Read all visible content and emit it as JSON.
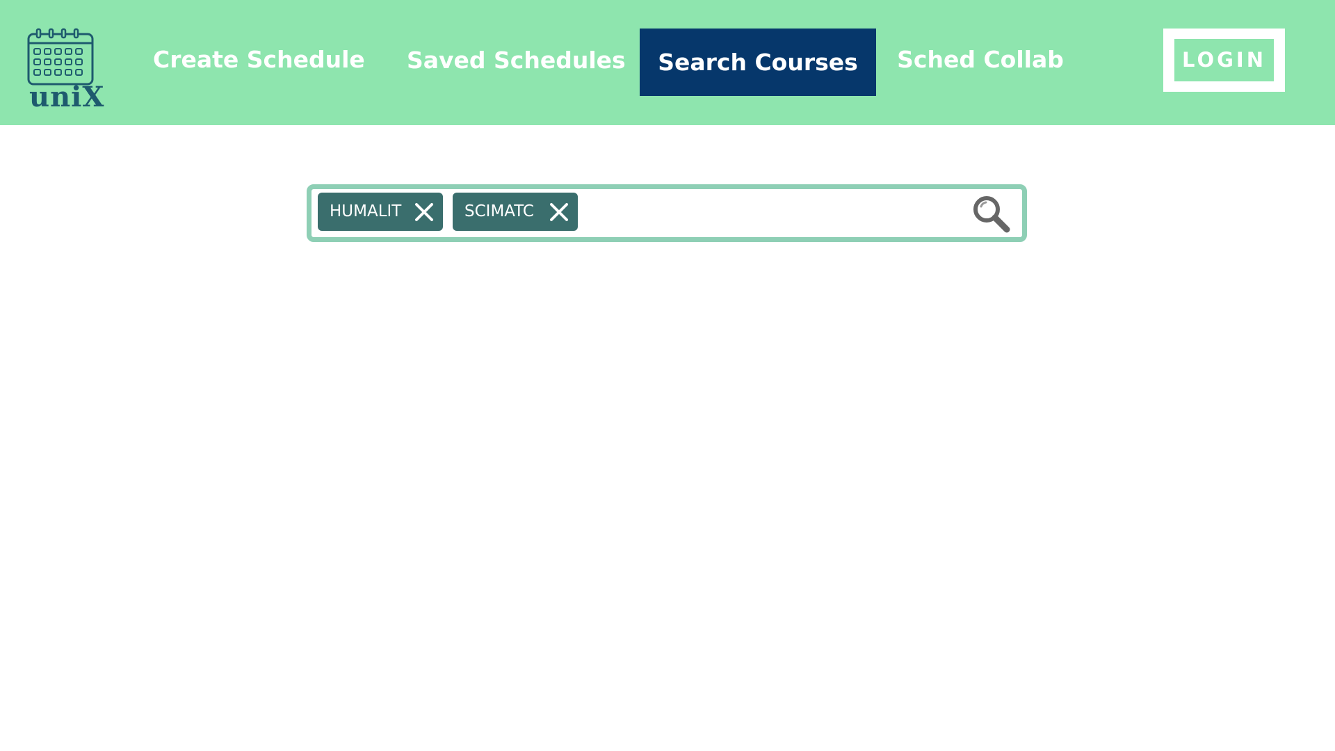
{
  "brand": {
    "name": "uniX",
    "icon": "calendar-icon"
  },
  "nav": {
    "items": [
      {
        "label": "Create Schedule",
        "active": false
      },
      {
        "label": "Saved Schedules",
        "active": false
      },
      {
        "label": "Search Courses",
        "active": true
      },
      {
        "label": "Sched Collab",
        "active": false
      }
    ],
    "login_label": "LOGIN"
  },
  "search": {
    "tags": [
      {
        "label": "HUMALIT",
        "remove_icon": "close-icon"
      },
      {
        "label": "SCIMATC",
        "remove_icon": "close-icon"
      }
    ],
    "value": "",
    "icon": "search-icon"
  },
  "colors": {
    "nav_background": "#8ee5ae",
    "active_tab": "#06376b",
    "chip": "#3a6e6d",
    "search_border": "#8ecfb5",
    "logo": "#1e5a6e"
  }
}
